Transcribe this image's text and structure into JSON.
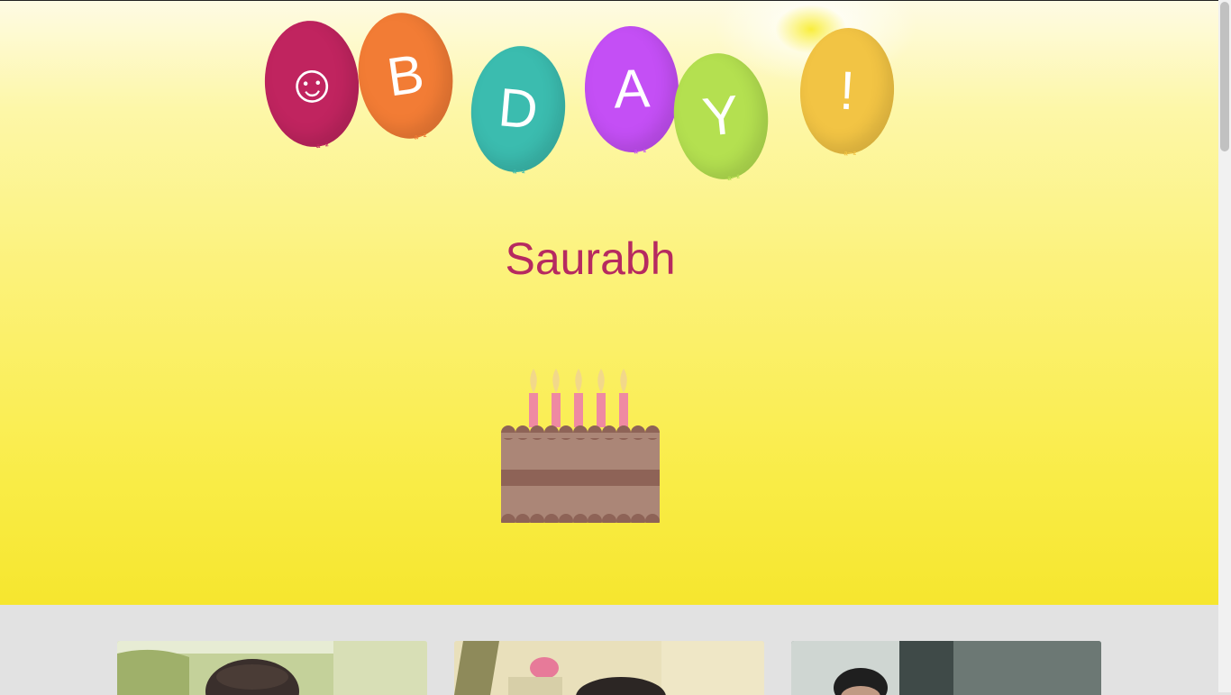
{
  "balloons": [
    {
      "letter": "☺",
      "color": "#c0245f",
      "knot_label": "ᵃ⁻²",
      "knot_color": "#c0245f"
    },
    {
      "letter": "B",
      "color": "#f27c35",
      "knot_label": "ᵃ⁻²",
      "knot_color": "#f27c35"
    },
    {
      "letter": "D",
      "color": "#3bbcaf",
      "knot_label": "ᵃ⁻²",
      "knot_color": "#3bbcaf"
    },
    {
      "letter": "A",
      "color": "#c44ff5",
      "knot_label": "ᵃ⁻²",
      "knot_color": "#c44ff5"
    },
    {
      "letter": "Y",
      "color": "#b4e050",
      "knot_label": "ᵃ⁻²",
      "knot_color": "#b4e050"
    },
    {
      "letter": "!",
      "color": "#f2c444",
      "knot_label": "ᵃ⁻²",
      "knot_color": "#f2c444"
    }
  ],
  "greeting": {
    "name": "Saurabh",
    "color": "#b62a60"
  },
  "cake": {
    "candle_count": 5,
    "sponge_color": "#ab8677",
    "filling_color": "#8e6357",
    "candle_color": "#ef8aa2",
    "flame_color": "#f2d88a"
  },
  "gallery": {
    "photos": [
      {
        "icon": "photo-icon",
        "label": "photo-1"
      },
      {
        "icon": "photo-icon",
        "label": "photo-2"
      },
      {
        "icon": "photo-icon",
        "label": "photo-3"
      }
    ]
  },
  "colors": {
    "hero_yellow": "#f9ec46",
    "gallery_bg": "#e2e2e2"
  }
}
